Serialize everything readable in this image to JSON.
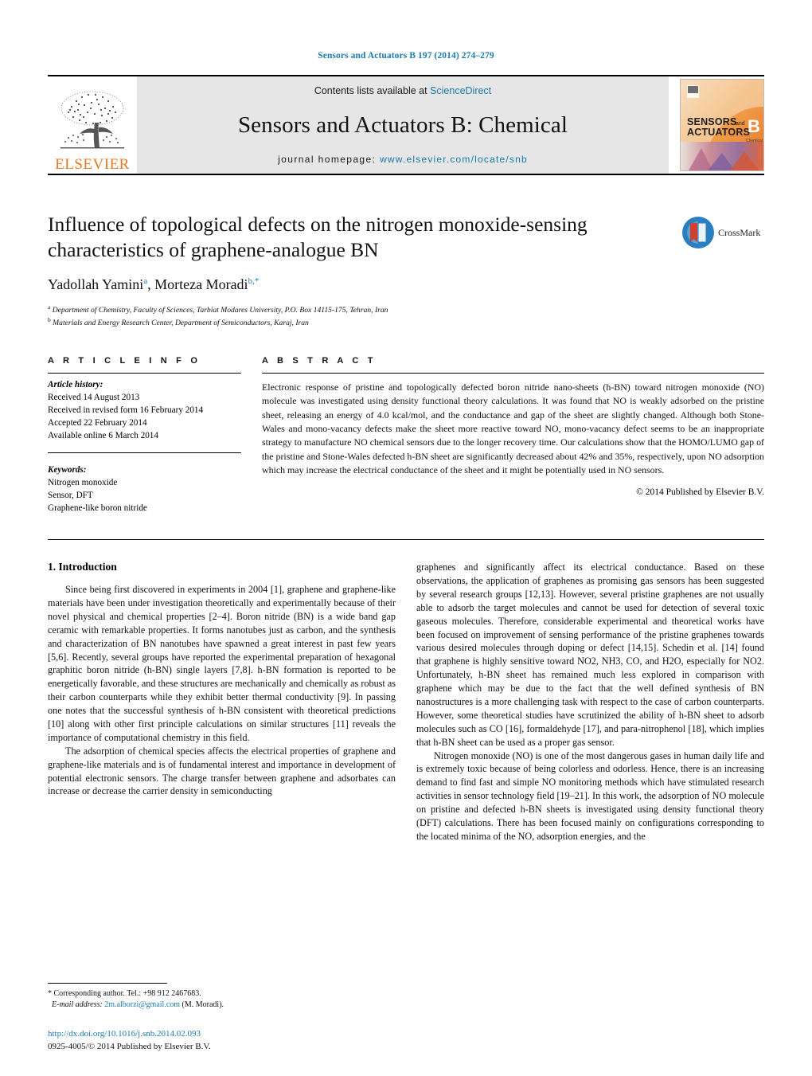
{
  "running_head": "Sensors and Actuators B 197 (2014) 274–279",
  "masthead": {
    "publisher_name": "ELSEVIER",
    "contents_prefix": "Contents lists available at ",
    "contents_link": "ScienceDirect",
    "journal_title": "Sensors and Actuators B: Chemical",
    "homepage_prefix": "journal homepage:",
    "homepage_url": "www.elsevier.com/locate/snb",
    "cover_line1": "SENSORS",
    "cover_and": "and",
    "cover_line2": "ACTUATORS",
    "cover_letter": "B",
    "cover_sub": "Chemical"
  },
  "article": {
    "title": "Influence of topological defects on the nitrogen monoxide-sensing characteristics of graphene-analogue BN",
    "authors": [
      {
        "name": "Yadollah Yamini",
        "marker": "a"
      },
      {
        "name": "Morteza Moradi",
        "marker": "b,*"
      }
    ],
    "affiliations": [
      {
        "marker": "a",
        "text": "Department of Chemistry, Faculty of Sciences, Tarbiat Modares University, P.O. Box 14115-175, Tehran, Iran"
      },
      {
        "marker": "b",
        "text": "Materials and Energy Research Center, Department of Semiconductors, Karaj, Iran"
      }
    ],
    "crossmark_label": "CrossMark"
  },
  "article_info": {
    "heading": "A R T I C L E    I N F O",
    "history_label": "Article history:",
    "history": [
      "Received 14 August 2013",
      "Received in revised form 16 February 2014",
      "Accepted 22 February 2014",
      "Available online 6 March 2014"
    ],
    "keywords_label": "Keywords:",
    "keywords": [
      "Nitrogen monoxide",
      "Sensor, DFT",
      "Graphene-like boron nitride"
    ]
  },
  "abstract": {
    "heading": "A B S T R A C T",
    "text": "Electronic response of pristine and topologically defected boron nitride nano-sheets (h-BN) toward nitrogen monoxide (NO) molecule was investigated using density functional theory calculations. It was found that NO is weakly adsorbed on the pristine sheet, releasing an energy of 4.0 kcal/mol, and the conductance and gap of the sheet are slightly changed. Although both Stone-Wales and mono-vacancy defects make the sheet more reactive toward NO, mono-vacancy defect seems to be an inappropriate strategy to manufacture NO chemical sensors due to the longer recovery time. Our calculations show that the HOMO/LUMO gap of the pristine and Stone-Wales defected h-BN sheet are significantly decreased about 42% and 35%, respectively, upon NO adsorption which may increase the electrical conductance of the sheet and it might be potentially used in NO sensors.",
    "copyright": "© 2014 Published by Elsevier B.V."
  },
  "body": {
    "section_number_title": "1.  Introduction",
    "left_paragraph_1": "Since being first discovered in experiments in 2004 [1], graphene and graphene-like materials have been under investigation theoretically and experimentally because of their novel physical and chemical properties [2–4]. Boron nitride (BN) is a wide band gap ceramic with remarkable properties. It forms nanotubes just as carbon, and the synthesis and characterization of BN nanotubes have spawned a great interest in past few years [5,6]. Recently, several groups have reported the experimental preparation of hexagonal graphitic boron nitride (h-BN) single layers [7,8]. h-BN formation is reported to be energetically favorable, and these structures are mechanically and chemically as robust as their carbon counterparts while they exhibit better thermal conductivity [9]. In passing one notes that the successful synthesis of h-BN consistent with theoretical predictions [10] along with other first principle calculations on similar structures [11] reveals the importance of computational chemistry in this field.",
    "left_paragraph_2": "The adsorption of chemical species affects the electrical properties of graphene and graphene-like materials and is of fundamental interest and importance in development of potential electronic sensors. The charge transfer between graphene and adsorbates can increase or decrease the carrier density in semiconducting",
    "right_paragraph_1": "graphenes and significantly affect its electrical conductance. Based on these observations, the application of graphenes as promising gas sensors has been suggested by several research groups [12,13]. However, several pristine graphenes are not usually able to adsorb the target molecules and cannot be used for detection of several toxic gaseous molecules. Therefore, considerable experimental and theoretical works have been focused on improvement of sensing performance of the pristine graphenes towards various desired molecules through doping or defect [14,15]. Schedin et al. [14] found that graphene is highly sensitive toward NO2, NH3, CO, and H2O, especially for NO2. Unfortunately, h-BN sheet has remained much less explored in comparison with graphene which may be due to the fact that the well defined synthesis of BN nanostructures is a more challenging task with respect to the case of carbon counterparts. However, some theoretical studies have scrutinized the ability of h-BN sheet to adsorb molecules such as CO [16], formaldehyde [17], and para-nitrophenol [18], which implies that h-BN sheet can be used as a proper gas sensor.",
    "right_paragraph_2": "Nitrogen monoxide (NO) is one of the most dangerous gases in human daily life and is extremely toxic because of being colorless and odorless. Hence, there is an increasing demand to find fast and simple NO monitoring methods which have stimulated research activities in sensor technology field [19–21]. In this work, the adsorption of NO molecule on pristine and defected h-BN sheets is investigated using density functional theory (DFT) calculations. There has been focused mainly on configurations corresponding to the located minima of the NO, adsorption energies, and the"
  },
  "footnote": {
    "star": "*",
    "corresponding": "Corresponding author. Tel.: +98 912 2467683.",
    "email_label": "E-mail address:",
    "email": "2m.alborzi@gmail.com",
    "email_suffix": "(M. Moradi)."
  },
  "footer": {
    "doi": "http://dx.doi.org/10.1016/j.snb.2014.02.093",
    "issn": "0925-4005/© 2014 Published by Elsevier B.V."
  },
  "colors": {
    "link": "#1a7aa8",
    "elsevier_orange": "#E87722"
  }
}
